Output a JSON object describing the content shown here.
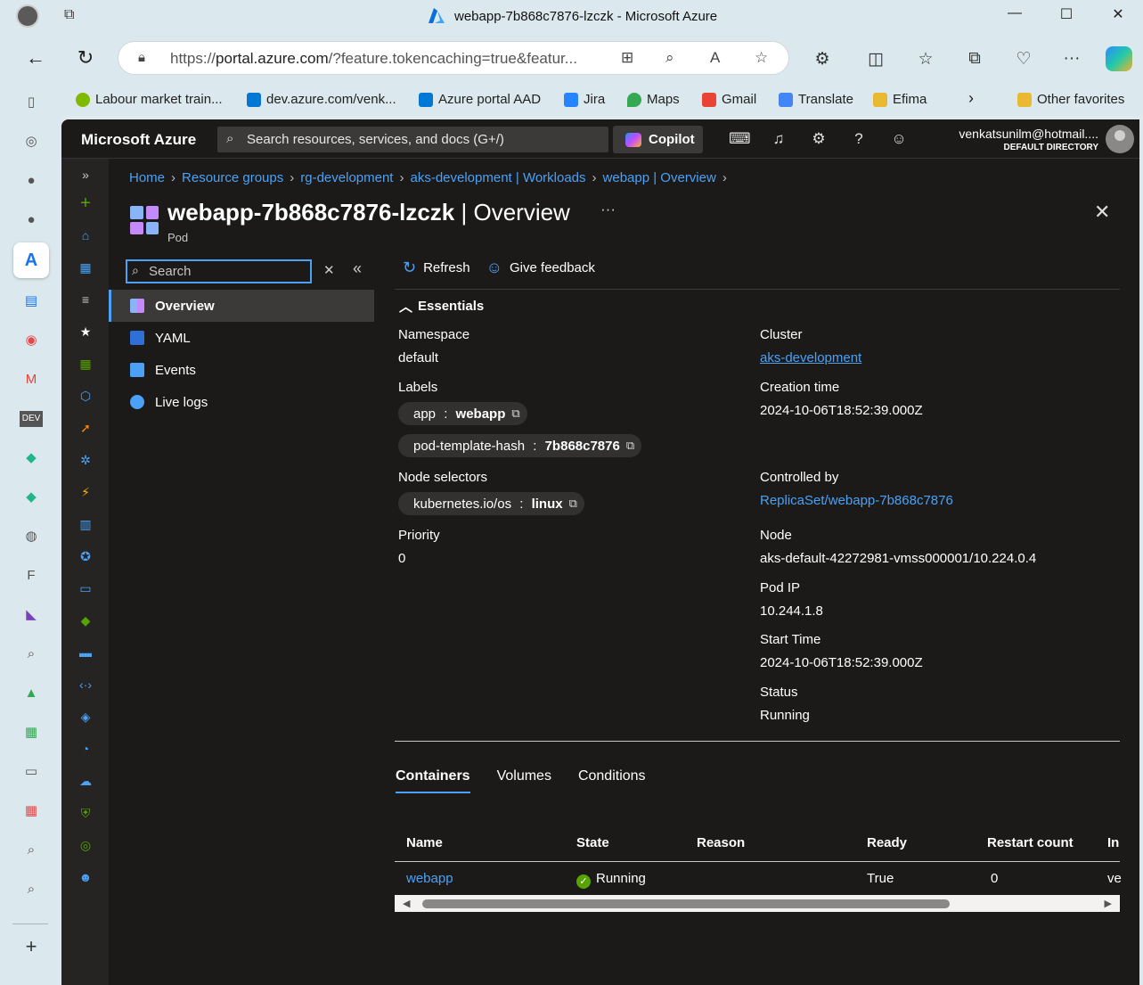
{
  "browser": {
    "window_title": "webapp-7b868c7876-lzczk - Microsoft Azure",
    "url_prefix": "https://",
    "url_host": "portal.azure.com",
    "url_rest": "/?feature.tokencaching=true&featur...",
    "favorites": [
      {
        "label": "Labour market train...",
        "color": "#7fba00"
      },
      {
        "label": "dev.azure.com/venk...",
        "color": "#0078d4"
      },
      {
        "label": "Azure portal AAD",
        "color": "#0078d4"
      },
      {
        "label": "Jira",
        "color": "#2684ff"
      },
      {
        "label": "Maps",
        "color": "#34a853"
      },
      {
        "label": "Gmail",
        "color": "#ea4335"
      },
      {
        "label": "Translate",
        "color": "#4285f4"
      },
      {
        "label": "Efima",
        "color": "#e8b931"
      }
    ],
    "other_favorites": "Other favorites"
  },
  "portal": {
    "brand": "Microsoft Azure",
    "search_placeholder": "Search resources, services, and docs (G+/)",
    "copilot": "Copilot",
    "user_name": "venkatsunilm@hotmail....",
    "user_directory": "DEFAULT DIRECTORY"
  },
  "breadcrumb": [
    "Home",
    "Resource groups",
    "rg-development",
    "aks-development | Workloads",
    "webapp | Overview"
  ],
  "page": {
    "title_bold": "webapp-7b868c7876-lzczk",
    "title_rest": " | Overview",
    "subtitle": "Pod",
    "more": "···"
  },
  "resource_menu": {
    "search_placeholder": "Search",
    "items": [
      {
        "label": "Overview",
        "active": true
      },
      {
        "label": "YAML"
      },
      {
        "label": "Events"
      },
      {
        "label": "Live logs"
      }
    ]
  },
  "commands": {
    "refresh": "Refresh",
    "feedback": "Give feedback"
  },
  "essentials": {
    "header": "Essentials",
    "namespace_label": "Namespace",
    "namespace_value": "default",
    "labels_label": "Labels",
    "labels": [
      {
        "key": "app",
        "value": "webapp"
      },
      {
        "key": "pod-template-hash",
        "value": "7b868c7876"
      }
    ],
    "node_selectors_label": "Node selectors",
    "node_selectors": [
      {
        "key": "kubernetes.io/os",
        "value": "linux"
      }
    ],
    "priority_label": "Priority",
    "priority_value": "0",
    "cluster_label": "Cluster",
    "cluster_value": "aks-development",
    "creation_label": "Creation time",
    "creation_value": "2024-10-06T18:52:39.000Z",
    "controlled_label": "Controlled by",
    "controlled_value": "ReplicaSet/webapp-7b868c7876",
    "node_label": "Node",
    "node_value": "aks-default-42272981-vmss000001/10.224.0.4",
    "podip_label": "Pod IP",
    "podip_value": "10.244.1.8",
    "start_label": "Start Time",
    "start_value": "2024-10-06T18:52:39.000Z",
    "status_label": "Status",
    "status_value": "Running"
  },
  "tabs": [
    "Containers",
    "Volumes",
    "Conditions"
  ],
  "containers_table": {
    "headers": [
      "Name",
      "State",
      "Reason",
      "Ready",
      "Restart count",
      "In"
    ],
    "rows": [
      {
        "name": "webapp",
        "state": "Running",
        "reason": "",
        "ready": "True",
        "restart_count": "0",
        "in": "ve"
      }
    ]
  }
}
